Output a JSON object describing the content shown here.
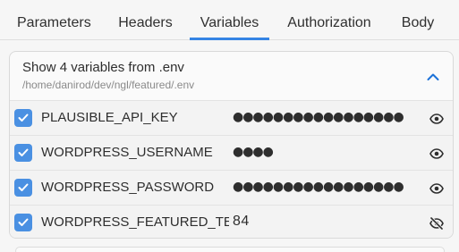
{
  "tabs": [
    {
      "label": "Parameters",
      "active": false
    },
    {
      "label": "Headers",
      "active": false
    },
    {
      "label": "Variables",
      "active": true
    },
    {
      "label": "Authorization",
      "active": false
    },
    {
      "label": "Body",
      "active": false
    }
  ],
  "env_panel": {
    "title": "Show 4 variables from .env",
    "path": "/home/danirod/dev/ngl/featured/.env",
    "expanded": true,
    "collapse_icon": "chevron-up-icon"
  },
  "variables": [
    {
      "name": "PLAUSIBLE_API_KEY",
      "value": "●●●●●●●●●●●●●●●●●",
      "masked": true,
      "checked": true,
      "visibility_icon": "eye-icon"
    },
    {
      "name": "WORDPRESS_USERNAME",
      "value": "●●●●",
      "masked": true,
      "checked": true,
      "visibility_icon": "eye-icon"
    },
    {
      "name": "WORDPRESS_PASSWORD",
      "value": "●●●●●●●●●●●●●●●●●",
      "masked": true,
      "checked": true,
      "visibility_icon": "eye-icon"
    },
    {
      "name": "WORDPRESS_FEATURED_TERM",
      "value": "84",
      "masked": false,
      "checked": true,
      "visibility_icon": "eye-off-icon"
    }
  ],
  "colors": {
    "accent": "#3584e4",
    "checkbox": "#4a90e2"
  }
}
